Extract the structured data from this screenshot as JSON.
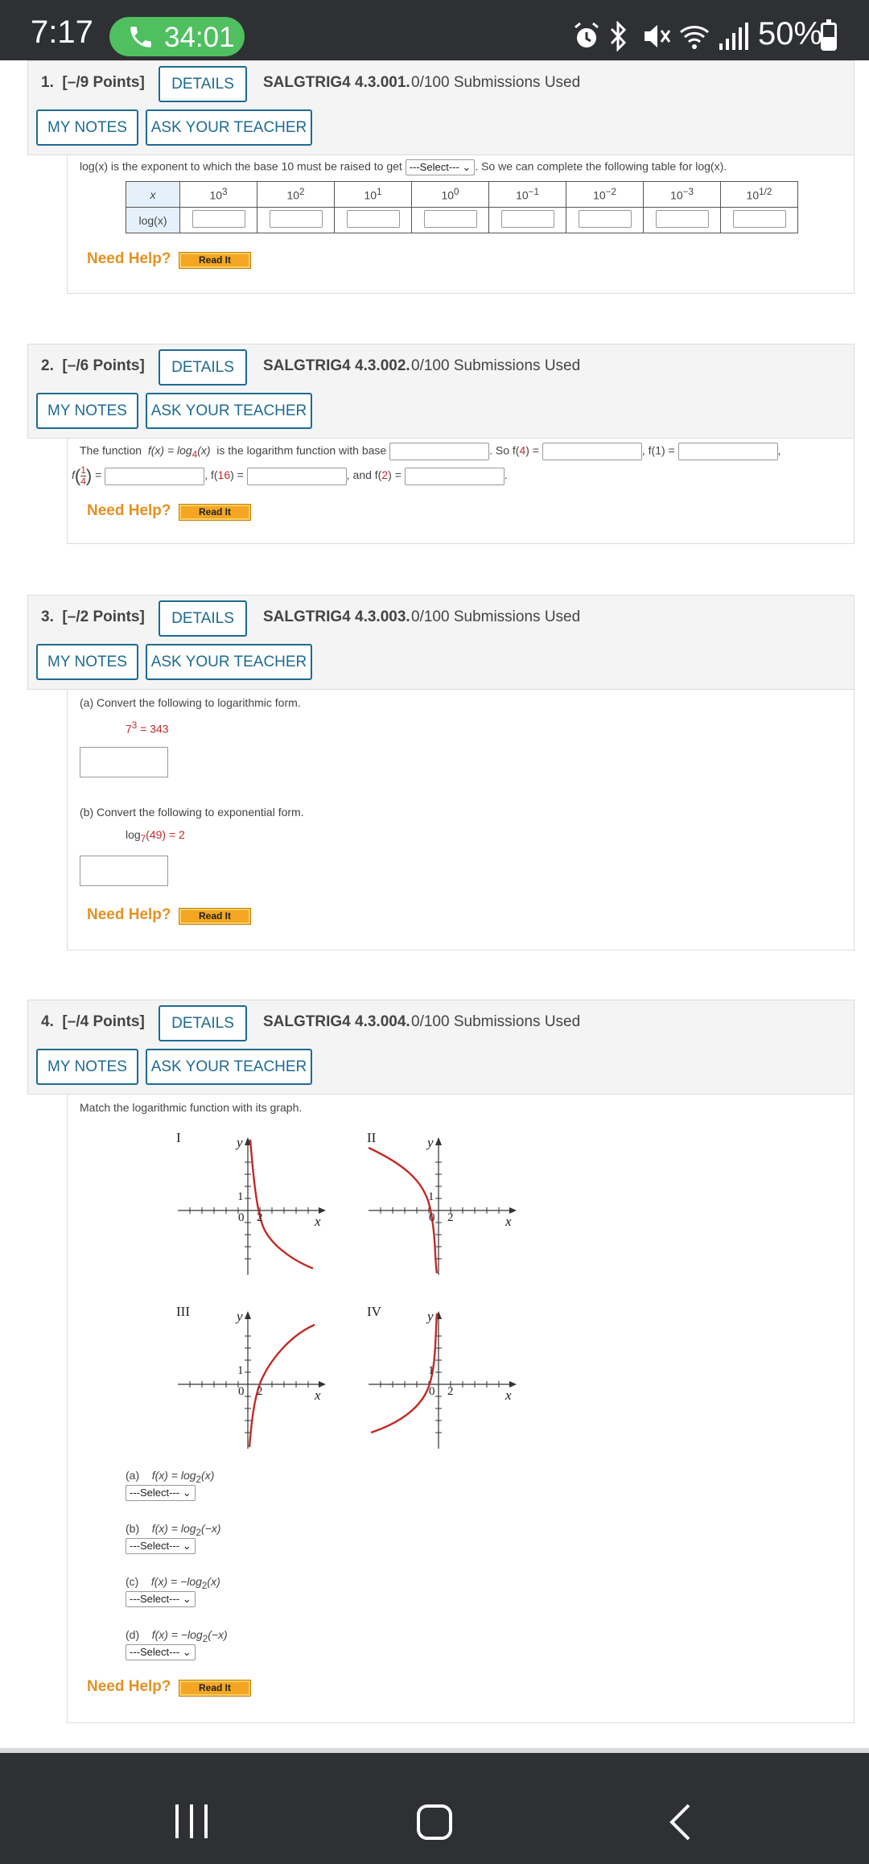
{
  "status_bar": {
    "time": "7:17",
    "call_duration": "34:01",
    "battery": "50%",
    "battery_level": 0.5
  },
  "questions": [
    {
      "number": "1.",
      "points": "[–/9 Points]",
      "details_label": "DETAILS",
      "code": "SALGTRIG4 4.3.001.",
      "submissions": "0/100 Submissions Used",
      "my_notes_label": "MY NOTES",
      "ask_teacher_label": "ASK YOUR TEACHER",
      "text_before_select": "log(x) is the exponent to which the base 10 must be raised to get",
      "select_value": "---Select---",
      "text_after_select": ". So we can complete the following table for log(x).",
      "table": {
        "x_header": "x",
        "log_header": "log(x)",
        "x_values": [
          {
            "base": "10",
            "exp": "3"
          },
          {
            "base": "10",
            "exp": "2"
          },
          {
            "base": "10",
            "exp": "1"
          },
          {
            "base": "10",
            "exp": "0"
          },
          {
            "base": "10",
            "exp": "−1"
          },
          {
            "base": "10",
            "exp": "−2"
          },
          {
            "base": "10",
            "exp": "−3"
          },
          {
            "base": "10",
            "exp": "1/2"
          }
        ]
      },
      "need_help": "Need Help?",
      "read_it": "Read It"
    },
    {
      "number": "2.",
      "points": "[–/6 Points]",
      "details_label": "DETAILS",
      "code": "SALGTRIG4 4.3.002.",
      "submissions": "0/100 Submissions Used",
      "my_notes_label": "MY NOTES",
      "ask_teacher_label": "ASK YOUR TEACHER",
      "line1": {
        "intro": "The function",
        "func": "f(x) = log",
        "sub": "4",
        "arg": "(x)",
        "tail": "is the logarithm function with base",
        "so": ". So f(",
        "v1": "4",
        "eq": ") =",
        "f1": ", f(1) =",
        "comma": ","
      },
      "line2": {
        "f": "f",
        "num": "1",
        "den": "4",
        "eq": "=",
        "f16a": ", f(",
        "f16v": "16",
        "f16b": ") =",
        "and": ", and f(",
        "v2": "2",
        "end": ") =",
        "period": "."
      },
      "need_help": "Need Help?",
      "read_it": "Read It"
    },
    {
      "number": "3.",
      "points": "[–/2 Points]",
      "details_label": "DETAILS",
      "code": "SALGTRIG4 4.3.003.",
      "submissions": "0/100 Submissions Used",
      "my_notes_label": "MY NOTES",
      "ask_teacher_label": "ASK YOUR TEACHER",
      "part_a": "(a) Convert the following to logarithmic form.",
      "expr_a": {
        "base": "7",
        "exp": "3",
        "rest": " = 343"
      },
      "part_b": "(b) Convert the following to exponential form.",
      "expr_b": {
        "log": "log",
        "sub": "7",
        "arg": "(49) = 2"
      },
      "need_help": "Need Help?",
      "read_it": "Read It"
    },
    {
      "number": "4.",
      "points": "[–/4 Points]",
      "details_label": "DETAILS",
      "code": "SALGTRIG4 4.3.004.",
      "submissions": "0/100 Submissions Used",
      "my_notes_label": "MY NOTES",
      "ask_teacher_label": "ASK YOUR TEACHER",
      "prompt": "Match the logarithmic function with its graph.",
      "graphs": [
        {
          "roman": "I",
          "y": "y",
          "x": "x",
          "one": "1",
          "zero": "0",
          "two": "2"
        },
        {
          "roman": "II",
          "y": "y",
          "x": "x",
          "one": "1",
          "zero": "0",
          "two": "2"
        },
        {
          "roman": "III",
          "y": "y",
          "x": "x",
          "one": "1",
          "zero": "0",
          "two": "2"
        },
        {
          "roman": "IV",
          "y": "y",
          "x": "x",
          "one": "1",
          "zero": "0",
          "two": "2"
        }
      ],
      "items": [
        {
          "letter": "(a)",
          "func": "f(x) = log",
          "sub": "2",
          "arg": "(x)",
          "select": "---Select---"
        },
        {
          "letter": "(b)",
          "func": "f(x) = log",
          "sub": "2",
          "arg": "(−x)",
          "select": "---Select---"
        },
        {
          "letter": "(c)",
          "func": "f(x) = −log",
          "sub": "2",
          "arg": "(x)",
          "select": "---Select---"
        },
        {
          "letter": "(d)",
          "func": "f(x) = −log",
          "sub": "2",
          "arg": "(−x)",
          "select": "---Select---"
        }
      ],
      "need_help": "Need Help?",
      "read_it": "Read It"
    }
  ],
  "colors": {
    "header_bg": "#f4f4f4",
    "button_blue": "#1d6b92",
    "need_help_orange": "#e59022",
    "curve_red": "#c22a26",
    "table_header_bg": "#e5f1fa",
    "system_bar": "#2e3033",
    "call_green": "#4fbf60"
  }
}
